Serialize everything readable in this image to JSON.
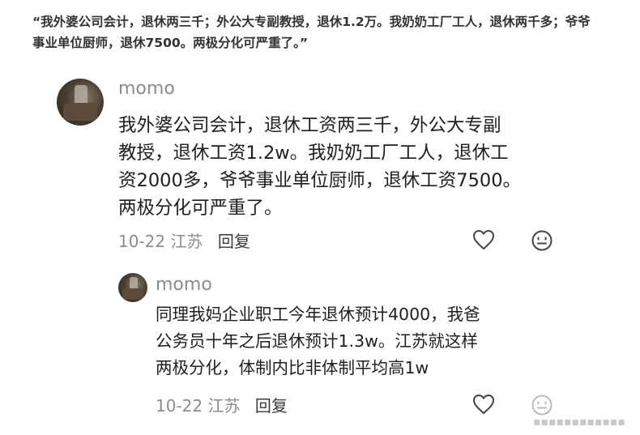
{
  "quote": "“我外婆公司会计，退休两三千；外公大专副教授，退休1.2万。我奶奶工厂工人，退休两千多；爷爷事业单位厨师，退休7500。两极分化可严重了。”",
  "comments": [
    {
      "username": "momo",
      "lines": [
        "我外婆公司会计，退休工资两三千，外公大专副",
        "教授，退休工资1.2w。我奶奶工厂工人，退休工",
        "资2000多，爷爷事业单位厨师，退休工资7500。",
        "两极分化可严重了。"
      ],
      "date": "10-22",
      "location": "江苏",
      "reply_label": "回复"
    },
    {
      "username": "momo",
      "lines": [
        "同理我妈企业职工今年退休预计4000，我爸",
        "公务员十年之后退休预计1.3w。江苏就这样",
        "两极分化，体制内比非体制平均高1w"
      ],
      "date": "10-22",
      "location": "江苏",
      "reply_label": "回复"
    }
  ],
  "icons": {
    "like": "heart-outline-icon",
    "emoji": "smiley-face-icon"
  },
  "watermark": "▪▪▪▪▪▪▪▪▪▪▪▪"
}
